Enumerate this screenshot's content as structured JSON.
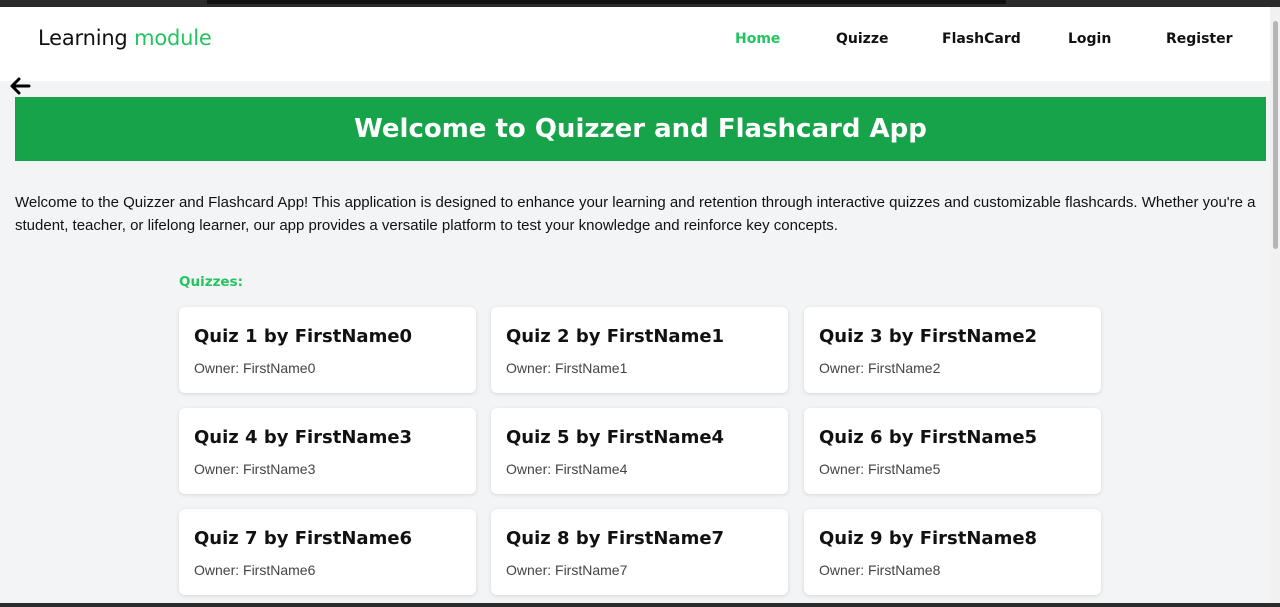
{
  "brand": {
    "main": "Learning",
    "accent": "module",
    "accent_color": "#22c55e"
  },
  "nav": {
    "items": [
      {
        "label": "Home",
        "active": true
      },
      {
        "label": "Quizze",
        "active": false
      },
      {
        "label": "FlashCard",
        "active": false
      },
      {
        "label": "Login",
        "active": false
      },
      {
        "label": "Register",
        "active": false
      }
    ]
  },
  "back": {
    "icon": "arrow-left-icon"
  },
  "hero": {
    "title": "Welcome to Quizzer and Flashcard App",
    "color": "#16a34a"
  },
  "intro": {
    "text": "Welcome to the Quizzer and Flashcard App! This application is designed to enhance your learning and retention through interactive quizzes and customizable flashcards. Whether you're a student, teacher, or lifelong learner, our app provides a versatile platform to test your knowledge and reinforce key concepts."
  },
  "quizzes": {
    "label": "Quizzes:",
    "items": [
      {
        "title": "Quiz 1 by FirstName0",
        "owner": "Owner: FirstName0"
      },
      {
        "title": "Quiz 2 by FirstName1",
        "owner": "Owner: FirstName1"
      },
      {
        "title": "Quiz 3 by FirstName2",
        "owner": "Owner: FirstName2"
      },
      {
        "title": "Quiz 4 by FirstName3",
        "owner": "Owner: FirstName3"
      },
      {
        "title": "Quiz 5 by FirstName4",
        "owner": "Owner: FirstName4"
      },
      {
        "title": "Quiz 6 by FirstName5",
        "owner": "Owner: FirstName5"
      },
      {
        "title": "Quiz 7 by FirstName6",
        "owner": "Owner: FirstName6"
      },
      {
        "title": "Quiz 8 by FirstName7",
        "owner": "Owner: FirstName7"
      },
      {
        "title": "Quiz 9 by FirstName8",
        "owner": "Owner: FirstName8"
      }
    ]
  }
}
